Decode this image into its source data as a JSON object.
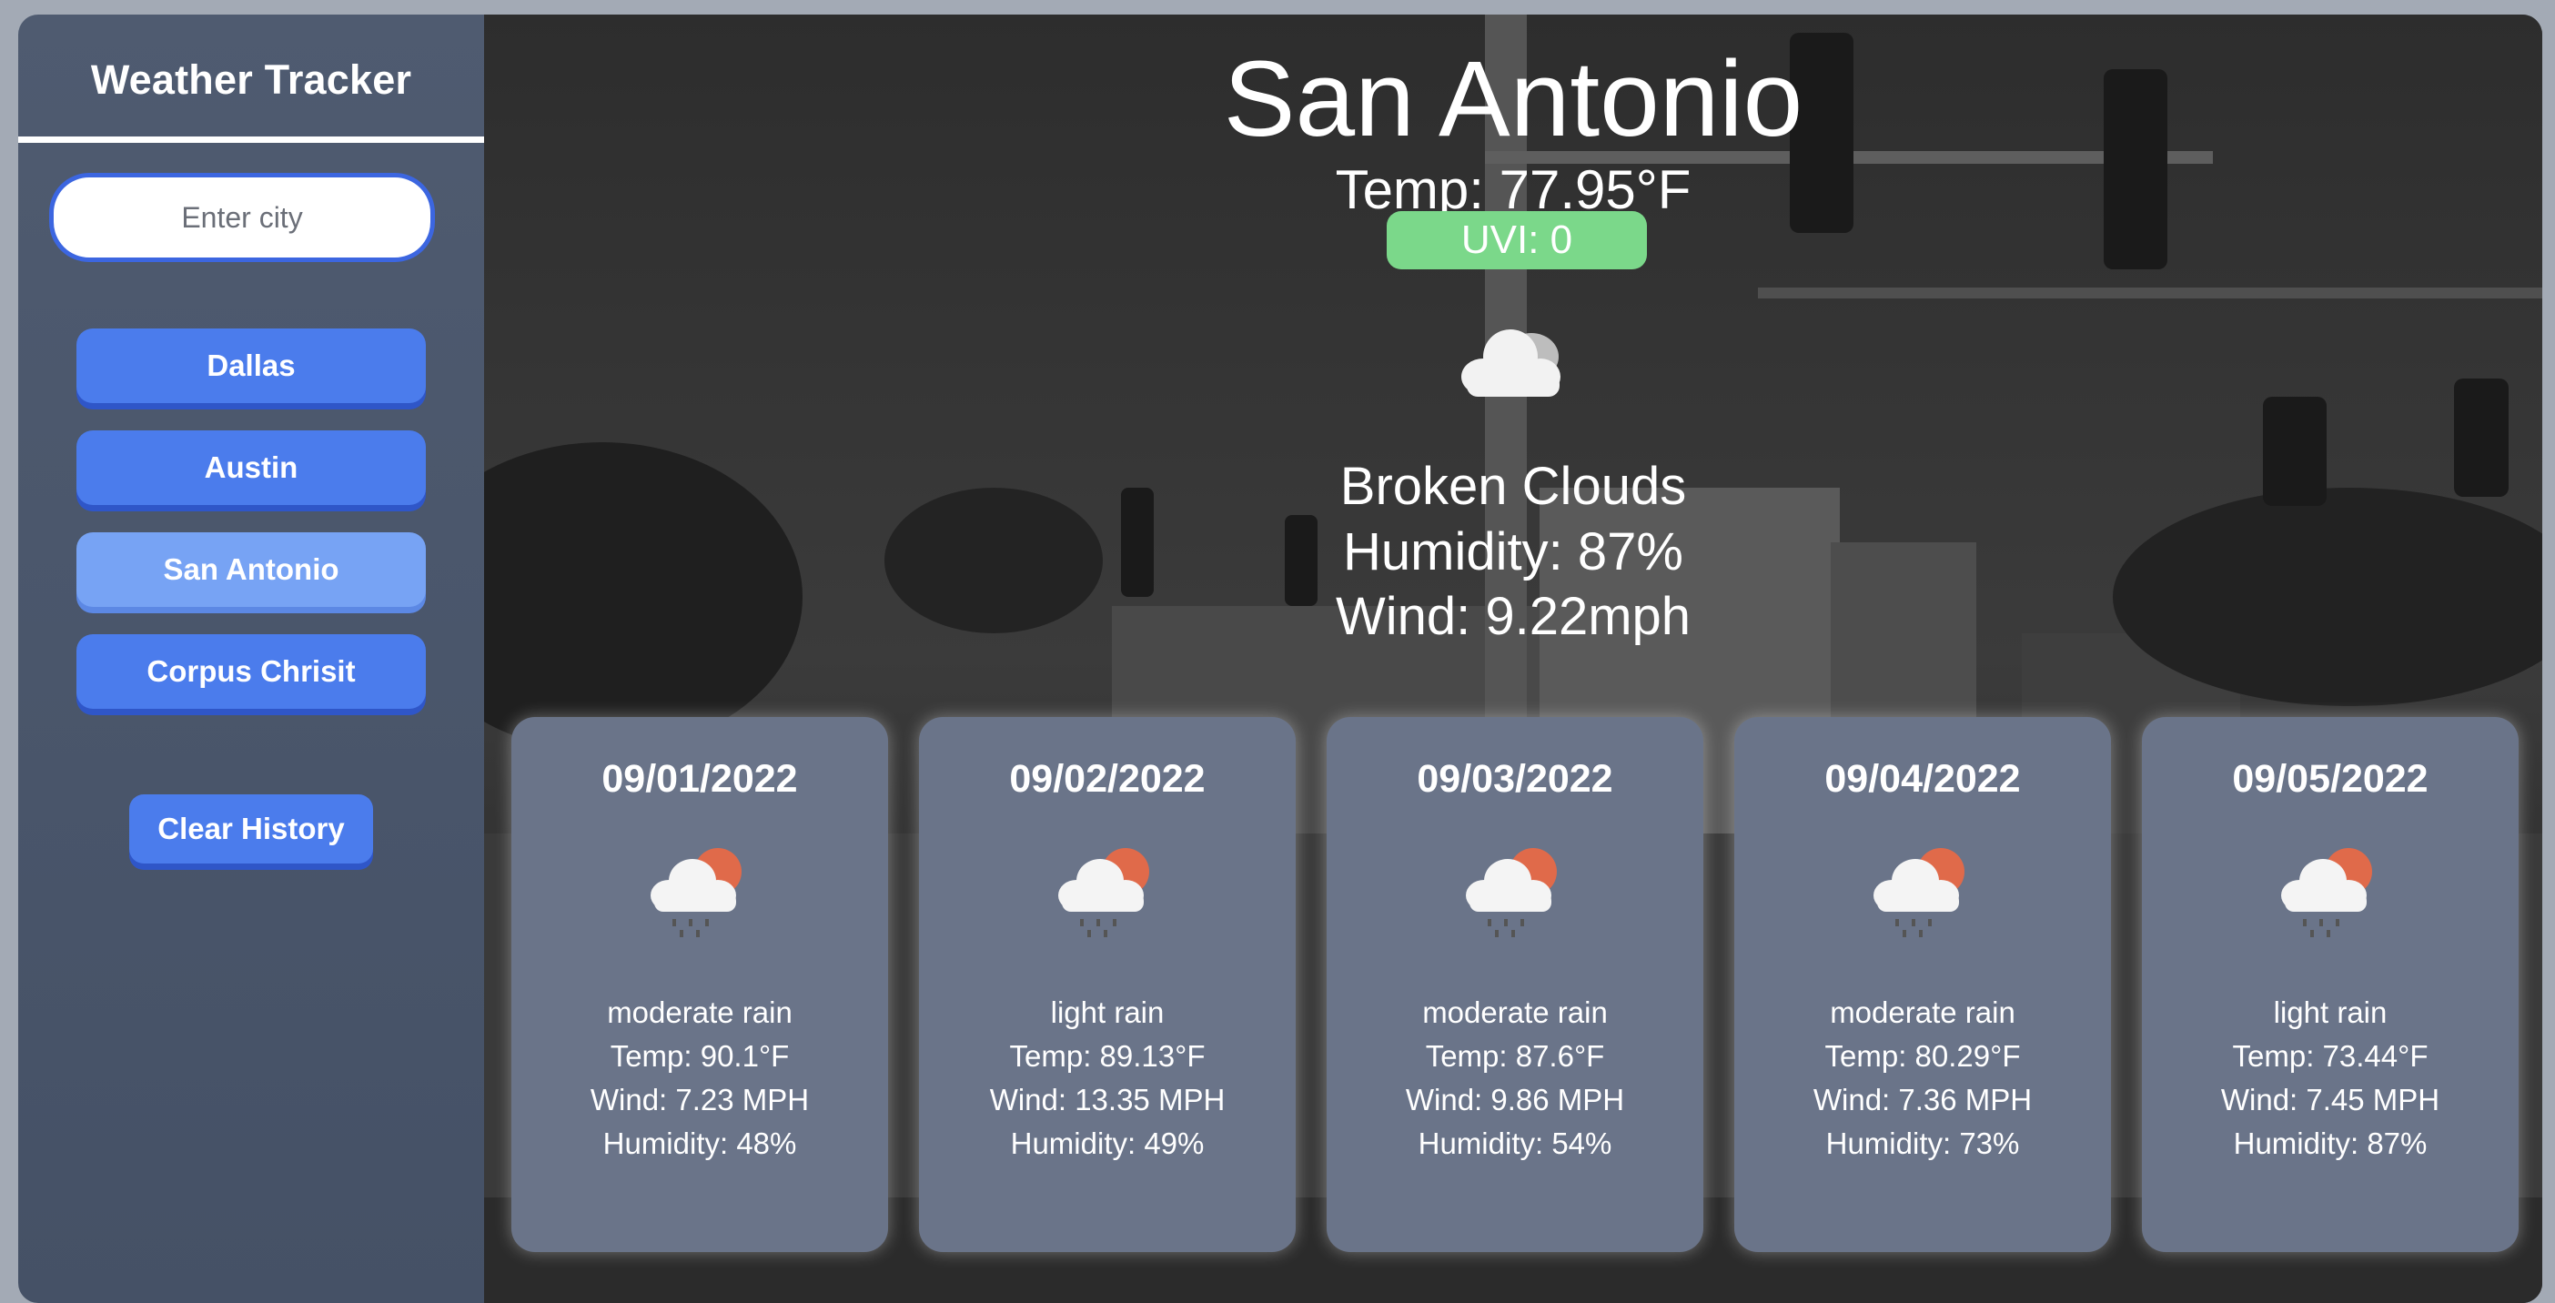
{
  "sidebar": {
    "title": "Weather Tracker",
    "search": {
      "placeholder": "Enter city",
      "value": ""
    },
    "history": [
      {
        "label": "Dallas",
        "active": false
      },
      {
        "label": "Austin",
        "active": false
      },
      {
        "label": "San Antonio",
        "active": true
      },
      {
        "label": "Corpus Chrisit",
        "active": false
      }
    ],
    "clear_label": "Clear History"
  },
  "current": {
    "city": "San Antonio",
    "temp": "Temp: 77.95°F",
    "uvi": "UVI: 0",
    "icon": "broken-clouds-icon",
    "description": "Broken Clouds",
    "humidity": "Humidity: 87%",
    "wind": "Wind: 9.22mph"
  },
  "forecast": [
    {
      "date": "09/01/2022",
      "icon": "rain-sun-cloud-icon",
      "description": "moderate rain",
      "temp": "Temp: 90.1°F",
      "wind": "Wind: 7.23 MPH",
      "humidity": "Humidity: 48%"
    },
    {
      "date": "09/02/2022",
      "icon": "rain-sun-cloud-icon",
      "description": "light rain",
      "temp": "Temp: 89.13°F",
      "wind": "Wind: 13.35 MPH",
      "humidity": "Humidity: 49%"
    },
    {
      "date": "09/03/2022",
      "icon": "rain-sun-cloud-icon",
      "description": "moderate rain",
      "temp": "Temp: 87.6°F",
      "wind": "Wind: 9.86 MPH",
      "humidity": "Humidity: 54%"
    },
    {
      "date": "09/04/2022",
      "icon": "rain-sun-cloud-icon",
      "description": "moderate rain",
      "temp": "Temp: 80.29°F",
      "wind": "Wind: 7.36 MPH",
      "humidity": "Humidity: 73%"
    },
    {
      "date": "09/05/2022",
      "icon": "rain-sun-cloud-icon",
      "description": "light rain",
      "temp": "Temp: 73.44°F",
      "wind": "Wind: 7.45 MPH",
      "humidity": "Humidity: 87%"
    }
  ],
  "colors": {
    "sidebar": "#4f5b70",
    "accent": "#4b7cec",
    "active_button": "#77a3f4",
    "uvi_low": "#7bd88a",
    "card": "#6a7489"
  }
}
